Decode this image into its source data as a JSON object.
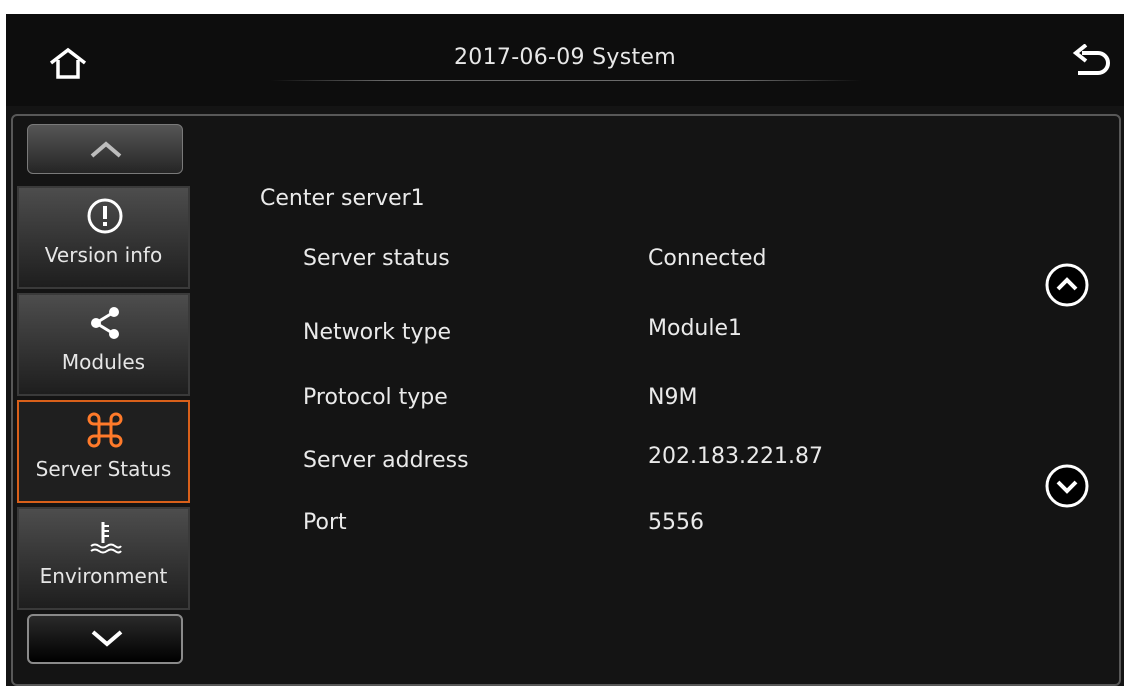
{
  "header": {
    "title": "2017-06-09  System"
  },
  "sidebar": {
    "items": [
      {
        "label": "Version info",
        "icon": "info-icon"
      },
      {
        "label": "Modules",
        "icon": "share-icon"
      },
      {
        "label": "Server Status",
        "icon": "command-icon",
        "active": true
      },
      {
        "label": "Environment",
        "icon": "temperature-icon"
      }
    ]
  },
  "main": {
    "section_title": "Center server1",
    "rows": [
      {
        "label": "Server status",
        "value": "Connected"
      },
      {
        "label": "Network type",
        "value": "Module1"
      },
      {
        "label": "Protocol type",
        "value": "N9M"
      },
      {
        "label": "Server address",
        "value": "202.183.221.87"
      },
      {
        "label": "Port",
        "value": "5556"
      }
    ]
  },
  "colors": {
    "background": "#141414",
    "accent": "#d9601a",
    "text": "#eaeaea"
  }
}
